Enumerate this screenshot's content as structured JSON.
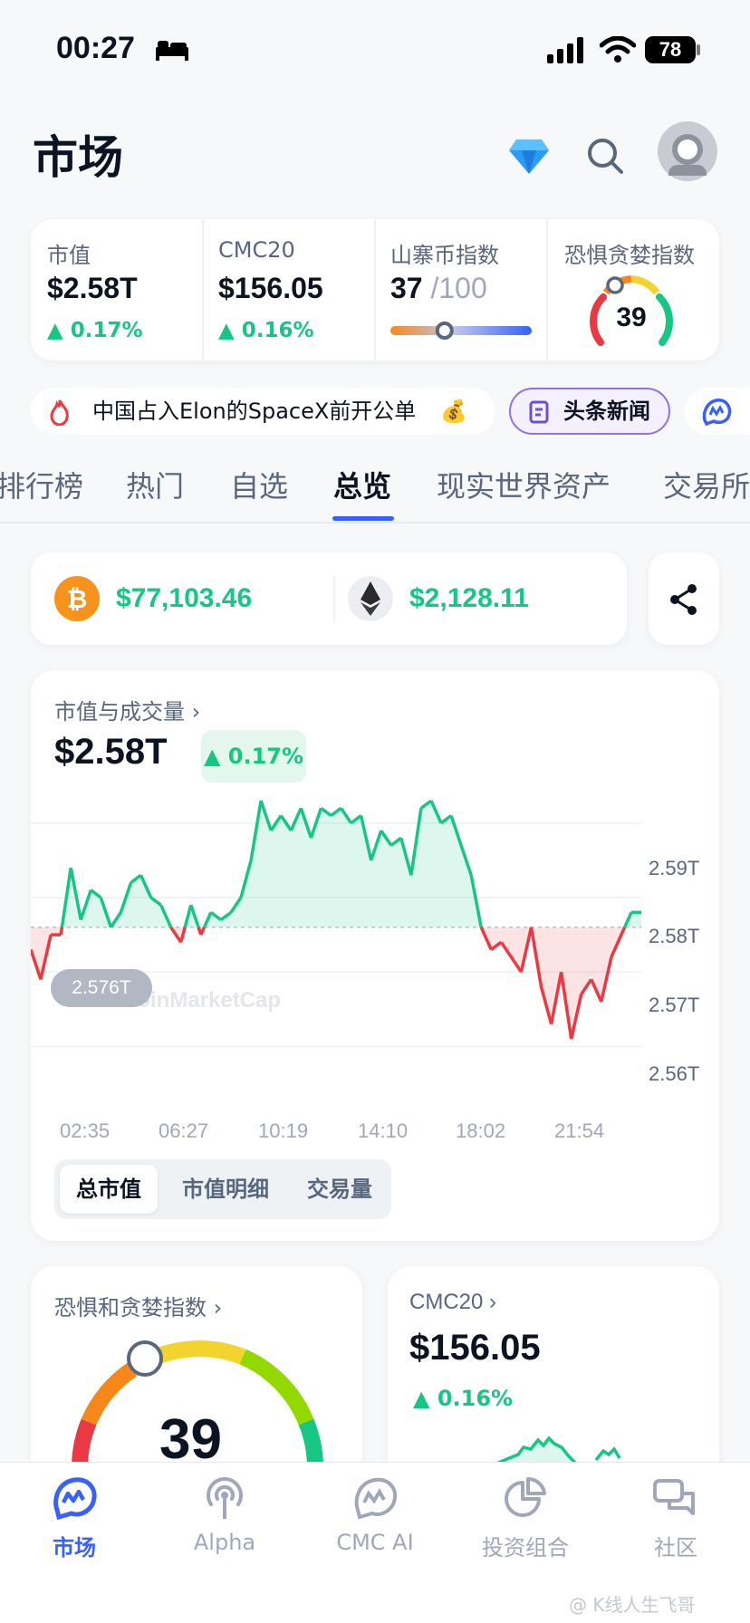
{
  "status_bar": {
    "time": "00:27",
    "battery": "78"
  },
  "header": {
    "title": "市场"
  },
  "stats": [
    {
      "label": "市值",
      "value": "$2.58T",
      "change": "0.17%"
    },
    {
      "label": "CMC20",
      "value": "$156.05",
      "change": "0.16%"
    },
    {
      "label": "山寨币指数",
      "value": "37",
      "max": "/100",
      "level": 0.37
    },
    {
      "label": "恐惧贪婪指数",
      "value": "39",
      "level": 0.39
    }
  ],
  "news": {
    "headline": "中国占入Elon的SpaceX前开公单",
    "emoji": "💰",
    "button": "头条新闻"
  },
  "tabs": [
    "排行榜",
    "热门",
    "自选",
    "总览",
    "现实世界资产",
    "交易所"
  ],
  "active_tab": "总览",
  "prices": {
    "btc": "$77,103.46",
    "eth": "$2,128.11"
  },
  "market_card": {
    "title": "市值与成交量",
    "value": "$2.58T",
    "change": "0.17%",
    "baseline_label": "2.576T",
    "watermark": "CoinMarketCap",
    "segments": [
      "总市值",
      "市值明细",
      "交易量"
    ],
    "active_segment": "总市值"
  },
  "chart_data": {
    "type": "line",
    "x_ticks": [
      "02:35",
      "06:27",
      "10:19",
      "14:10",
      "18:02",
      "21:54"
    ],
    "y_ticks": [
      "2.59T",
      "2.58T",
      "2.57T",
      "2.56T"
    ],
    "ylim": [
      2.557,
      2.5935
    ],
    "baseline": 2.576,
    "series": [
      {
        "values": [
          2.573,
          2.569,
          2.575,
          2.575,
          2.584,
          2.577,
          2.581,
          2.58,
          2.576,
          2.578,
          2.582,
          2.583,
          2.58,
          2.579,
          2.576,
          2.574,
          2.579,
          2.575,
          2.578,
          2.577,
          2.578,
          2.58,
          2.585,
          2.593,
          2.589,
          2.591,
          2.589,
          2.592,
          2.588,
          2.592,
          2.591,
          2.592,
          2.59,
          2.591,
          2.585,
          2.589,
          2.587,
          2.588,
          2.583,
          2.592,
          2.593,
          2.59,
          2.591,
          2.587,
          2.583,
          2.576,
          2.573,
          2.574,
          2.572,
          2.57,
          2.576,
          2.568,
          2.563,
          2.57,
          2.561,
          2.567,
          2.569,
          2.566,
          2.572,
          2.575,
          2.578,
          2.578
        ]
      }
    ]
  },
  "bottom_cards": {
    "fear_greed": {
      "title": "恐惧和贪婪指数",
      "value": "39",
      "level": 0.39
    },
    "cmc20": {
      "title": "CMC20",
      "value": "$156.05",
      "change": "0.16%"
    }
  },
  "nav": [
    {
      "label": "市场",
      "icon": "market-icon"
    },
    {
      "label": "Alpha",
      "icon": "alpha-icon"
    },
    {
      "label": "CMC AI",
      "icon": "cmc-ai-icon"
    },
    {
      "label": "投资组合",
      "icon": "portfolio-icon"
    },
    {
      "label": "社区",
      "icon": "community-icon"
    }
  ],
  "watermark": "@ K线人生飞哥",
  "colors": {
    "up": "#16c784",
    "down": "#ea3943",
    "accent": "#3861fb"
  }
}
